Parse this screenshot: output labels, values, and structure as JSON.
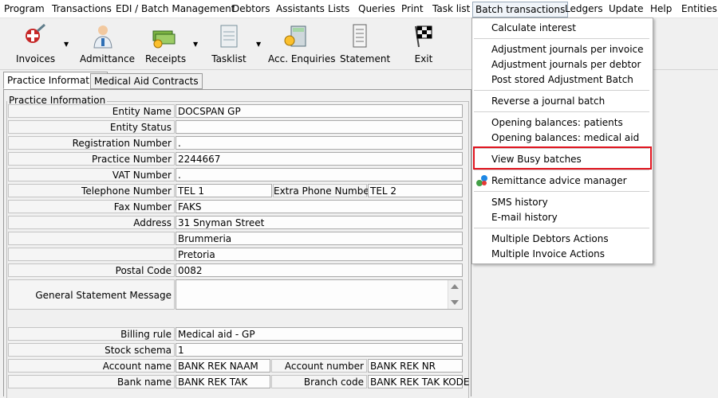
{
  "menubar": {
    "items": [
      "Program",
      "Transactions",
      "EDI / Batch Management",
      "Debtors",
      "Assistants",
      "Lists",
      "Queries",
      "Print",
      "Task list",
      "Batch transactions",
      "Ledgers",
      "Update",
      "Help",
      "Entities"
    ]
  },
  "toolbar": {
    "items": [
      {
        "label": "Invoices",
        "icon": "syringe-icon"
      },
      {
        "label": "Admittance",
        "icon": "doctor-icon"
      },
      {
        "label": "Receipts",
        "icon": "money-icon"
      },
      {
        "label": "Tasklist",
        "icon": "task-icon"
      },
      {
        "label": "Acc. Enquiries",
        "icon": "calculator-icon"
      },
      {
        "label": "Statement",
        "icon": "statement-icon"
      },
      {
        "label": "Exit",
        "icon": "checkered-flag-icon"
      }
    ]
  },
  "tabs": [
    "Practice Information",
    "Medical Aid Contracts"
  ],
  "group_title": "Practice Information",
  "fields": {
    "entity_name": {
      "label": "Entity Name",
      "value": "DOCSPAN GP"
    },
    "entity_status": {
      "label": "Entity Status",
      "value": ""
    },
    "registration_number": {
      "label": "Registration Number",
      "value": "."
    },
    "practice_number": {
      "label": "Practice Number",
      "value": "2244667"
    },
    "vat_number": {
      "label": "VAT Number",
      "value": "."
    },
    "telephone_number": {
      "label": "Telephone Number",
      "value": "TEL 1"
    },
    "extra_phone_number": {
      "label": "Extra Phone Number",
      "value": "TEL 2"
    },
    "fax_number": {
      "label": "Fax Number",
      "value": "FAKS"
    },
    "address": {
      "label": "Address",
      "lines": [
        "31 Snyman Street",
        "Brummeria",
        "Pretoria"
      ]
    },
    "postal_code": {
      "label": "Postal Code",
      "value": "0082"
    },
    "general_statement_message": {
      "label": "General Statement Message",
      "value": ""
    },
    "billing_rule": {
      "label": "Billing rule",
      "value": "Medical aid - GP"
    },
    "stock_schema": {
      "label": "Stock schema",
      "value": "1"
    },
    "account_name": {
      "label": "Account name",
      "value": "BANK REK NAAM"
    },
    "account_number": {
      "label": "Account number",
      "value": "BANK REK NR"
    },
    "bank_name": {
      "label": "Bank name",
      "value": "BANK REK TAK"
    },
    "branch_code": {
      "label": "Branch code",
      "value": "BANK REK TAK KODE"
    }
  },
  "dropdown": {
    "items": [
      "Calculate interest",
      "Adjustment journals per invoice",
      "Adjustment journals per debtor",
      "Post stored Adjustment Batch",
      "Reverse a journal batch",
      "Opening balances: patients",
      "Opening balances: medical aid",
      "View Busy batches",
      "Remittance advice manager",
      "SMS history",
      "E-mail history",
      "Multiple Debtors Actions",
      "Multiple Invoice Actions"
    ],
    "highlighted": "View Busy batches"
  },
  "colors": {
    "highlight_border": "#e0141e"
  }
}
